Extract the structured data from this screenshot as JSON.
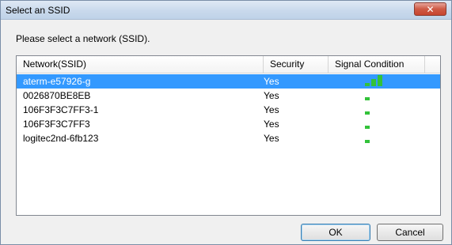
{
  "window": {
    "title": "Select an SSID",
    "close_label": "✕"
  },
  "prompt": "Please select a network (SSID).",
  "list": {
    "columns": [
      "Network(SSID)",
      "Security",
      "Signal Condition"
    ],
    "rows": [
      {
        "ssid": "aterm-e57926-g",
        "security": "Yes",
        "signal": 3,
        "selected": true
      },
      {
        "ssid": "0026870BE8EB",
        "security": "Yes",
        "signal": 1,
        "selected": false
      },
      {
        "ssid": "106F3F3C7FF3-1",
        "security": "Yes",
        "signal": 1,
        "selected": false
      },
      {
        "ssid": "106F3F3C7FF3",
        "security": "Yes",
        "signal": 1,
        "selected": false
      },
      {
        "ssid": "logitec2nd-6fb123",
        "security": "Yes",
        "signal": 1,
        "selected": false
      }
    ]
  },
  "buttons": {
    "ok": "OK",
    "cancel": "Cancel"
  },
  "colors": {
    "selection": "#3399ff",
    "signal_bar": "#33c23a"
  }
}
